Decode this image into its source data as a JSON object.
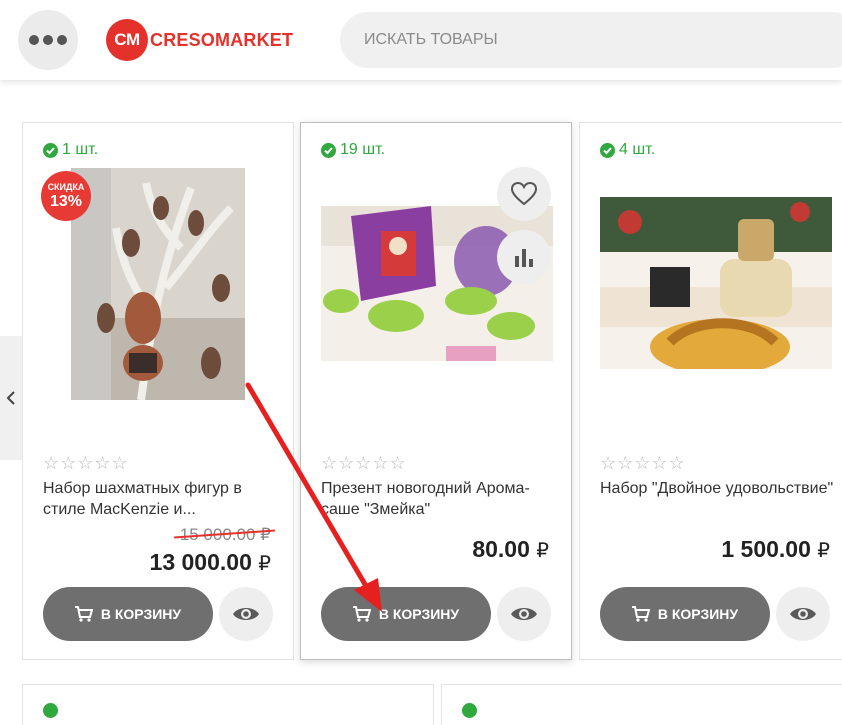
{
  "header": {
    "logo_mark": "CM",
    "logo_text": "CRESOMARKET",
    "search_placeholder": "ИСКАТЬ ТОВАРЫ"
  },
  "products": [
    {
      "stock": "1 шт.",
      "discount_label": "СКИДКА",
      "discount_value": "13%",
      "title": "Набор шахматных фигур в стиле MacKenzie и...",
      "old_price": "15 000.00",
      "price": "13 000.00",
      "currency": "₽",
      "cart_label": "В КОРЗИНУ",
      "rating": 0
    },
    {
      "stock": "19 шт.",
      "title": "Презент новогодний Арома-саше \"Змейка\"",
      "price": "80.00",
      "currency": "₽",
      "cart_label": "В КОРЗИНУ",
      "rating": 0
    },
    {
      "stock": "4 шт.",
      "title": "Набор \"Двойное удовольствие\"",
      "price": "1 500.00",
      "currency": "₽",
      "cart_label": "В КОРЗИНУ",
      "rating": 0
    }
  ],
  "colors": {
    "brand": "#e4312b",
    "stock": "#2fa83d",
    "button": "#6f6f6f",
    "annotation_arrow": "#e5201f"
  }
}
